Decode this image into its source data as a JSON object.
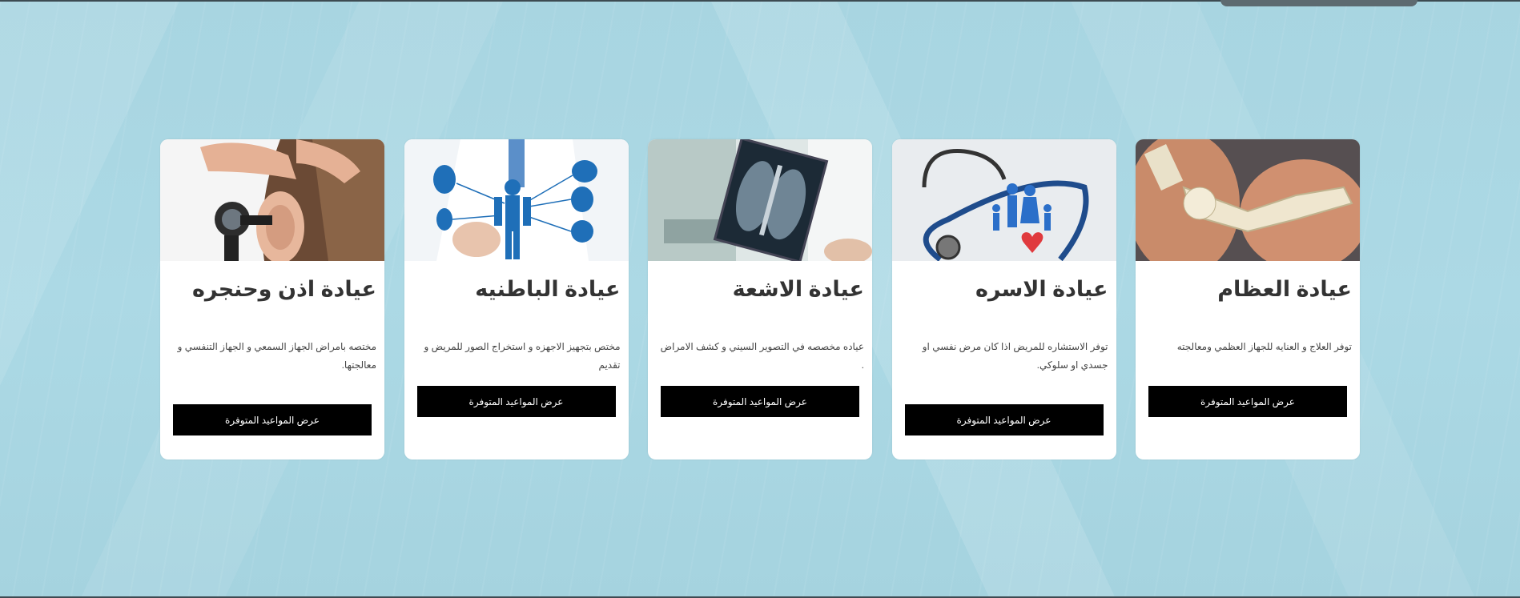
{
  "button_label": "عرض المواعيد المتوفرة",
  "cards": [
    {
      "title": "عيادة العظام",
      "description": "توفر العلاج و العنايه للجهاز العظمي ومعالجته",
      "image_icon": "bone-skeleton-foot-icon"
    },
    {
      "title": "عيادة الاسره",
      "description": "توفر الاستشاره للمريض اذا كان مرض نفسي او جسدي او سلوكي.",
      "image_icon": "stethoscope-family-icon"
    },
    {
      "title": "عيادة الاشعة",
      "description": "عياده مخصصه في التصوير السيني و كشف الامراض .",
      "image_icon": "chest-xray-icon"
    },
    {
      "title": "عيادة الباطنيه",
      "description": "مختص بتجهيز الاجهزه و استخراج الصور للمريض و تقديم",
      "image_icon": "internal-organs-icon"
    },
    {
      "title": "عيادة اذن وحنجره",
      "description": "مختصه بامراض الجهاز السمعي و الجهاز التنفسي و معالجتها.",
      "image_icon": "otoscope-ear-icon"
    }
  ],
  "colors": {
    "background": "#a9d6e2",
    "card": "#ffffff",
    "button": "#000000",
    "button_text": "#ffffff"
  }
}
